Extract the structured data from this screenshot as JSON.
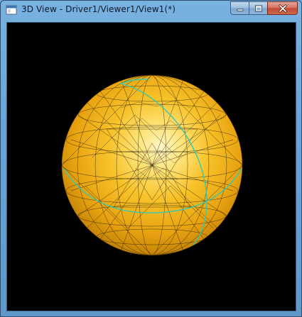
{
  "window": {
    "title": "3D View - Driver1/Viewer1/View1(*)",
    "icons": {
      "app": "window-app-icon",
      "minimize": "minimize-icon",
      "maximize": "maximize-icon",
      "close": "close-icon"
    }
  },
  "scene": {
    "object": "sphere-mesh",
    "background_color": "#000000",
    "surface_color": "#f2b51a",
    "highlight_color": "#fff6c8",
    "wire_color": "#1a1200",
    "edge_curve_color": "#35c9b0"
  }
}
